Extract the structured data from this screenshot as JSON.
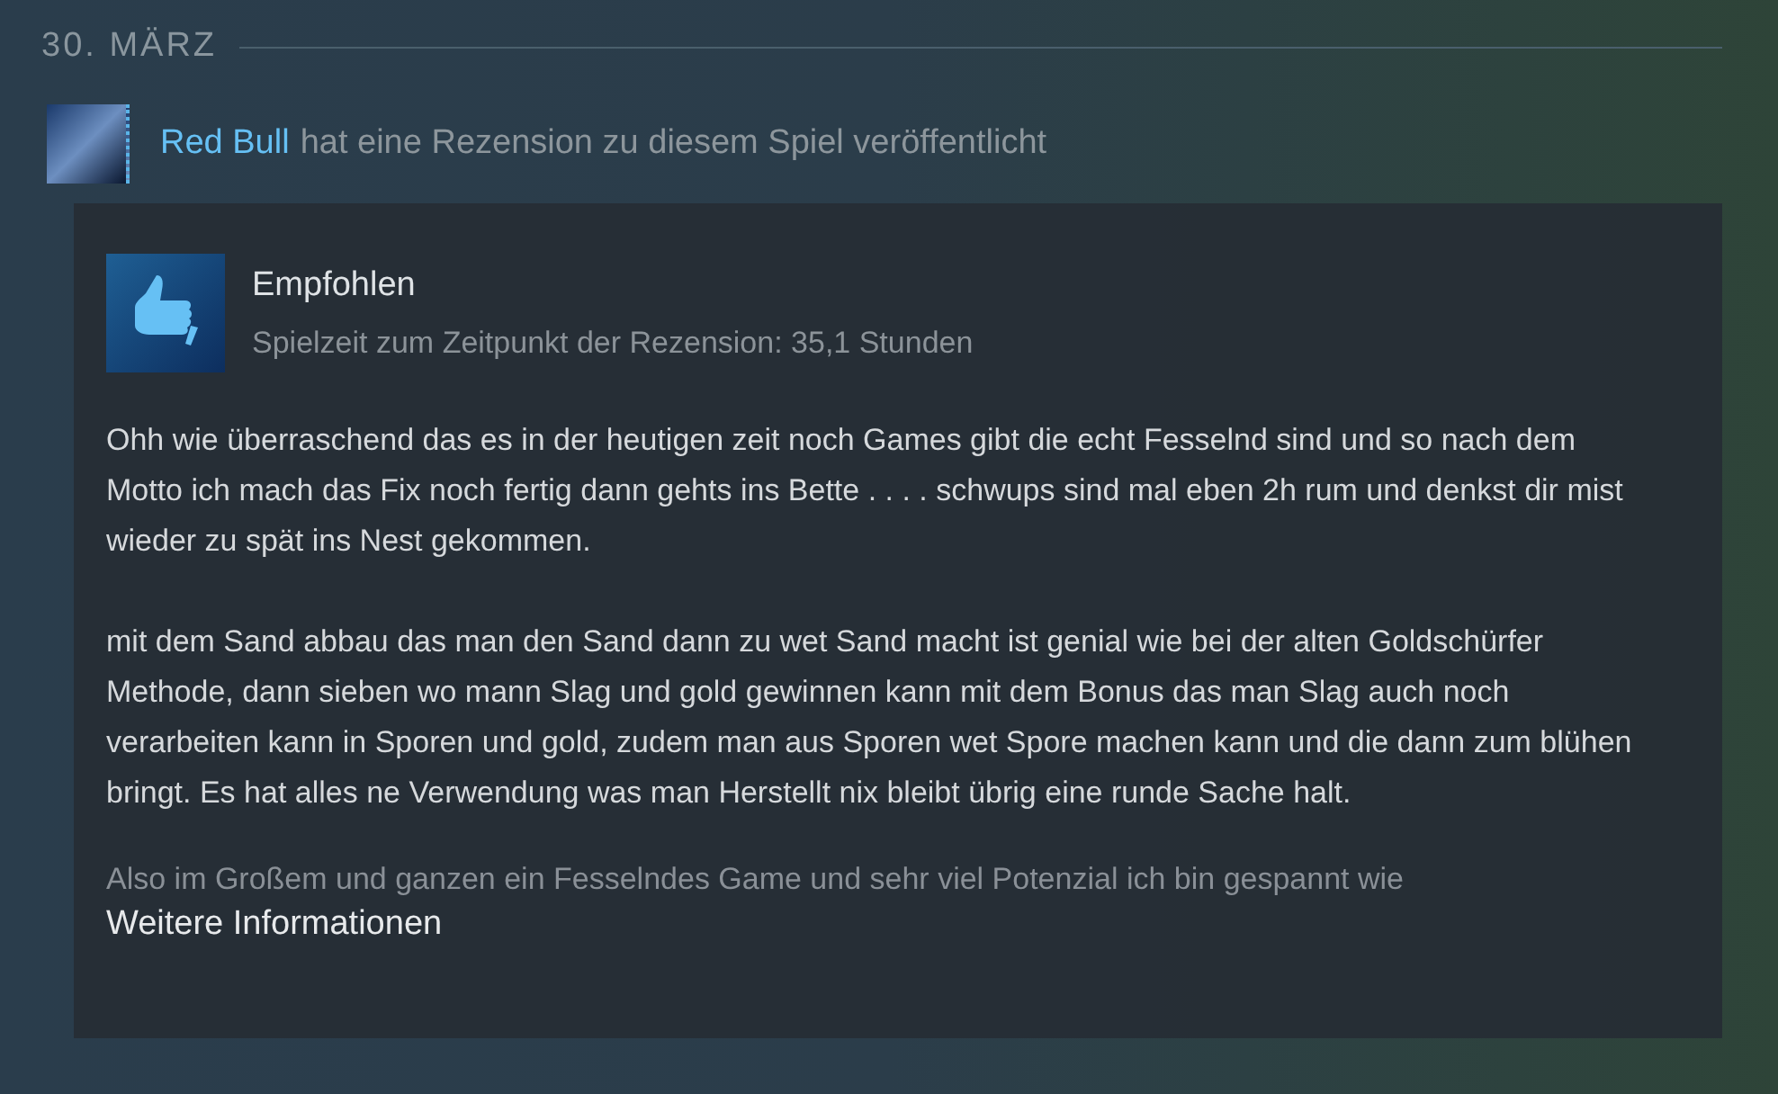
{
  "date": "30. MÄRZ",
  "activity": {
    "author": "Red Bull",
    "text": "hat eine Rezension zu diesem Spiel veröffentlicht"
  },
  "review": {
    "verdict": "Empfohlen",
    "recommended": true,
    "playtime": "Spielzeit zum Zeitpunkt der Rezension: 35,1 Stunden",
    "paragraphs": [
      "Ohh wie überraschend das es in der heutigen zeit noch Games gibt die echt Fesselnd sind und so nach dem Motto ich mach das Fix noch fertig dann gehts ins Bette . . . . schwups sind mal eben 2h rum und denkst dir mist wieder zu spät ins Nest gekommen.",
      "mit dem Sand abbau das man den Sand dann zu wet Sand macht ist genial wie bei der alten Goldschürfer Methode, dann sieben wo mann Slag und gold gewinnen kann mit dem Bonus das man Slag auch noch verarbeiten kann in Sporen und gold, zudem man aus Sporen wet Spore machen kann und die dann zum blühen bringt. Es hat alles ne Verwendung was man Herstellt nix bleibt übrig eine runde Sache halt."
    ],
    "faded_line": "Also im Großem und ganzen ein Fesselndes Game und sehr viel Potenzial ich bin gespannt wie",
    "more_link": "Weitere Informationen"
  }
}
